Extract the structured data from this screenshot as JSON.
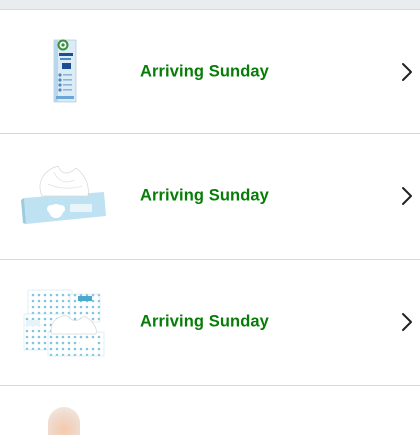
{
  "orders": [
    {
      "status": "Arriving Sunday",
      "product_image": "eye-drops-box-image"
    },
    {
      "status": "Arriving Sunday",
      "product_image": "facial-tissue-box-image"
    },
    {
      "status": "Arriving Sunday",
      "product_image": "tissue-multipack-image"
    }
  ],
  "colors": {
    "status_green": "#067d06",
    "divider": "#d5d9d9",
    "top_strip": "#eaeded"
  },
  "icons": {
    "row_chevron": "chevron-right-icon"
  }
}
